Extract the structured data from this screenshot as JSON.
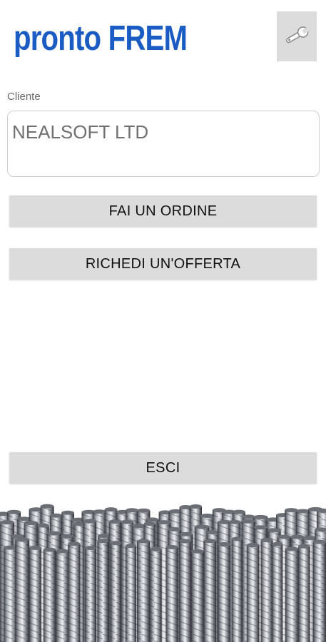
{
  "app": {
    "logo_text": "pronto FREM"
  },
  "toolbar": {
    "settings_icon": "wrench-icon"
  },
  "form": {
    "cliente_label": "Cliente",
    "cliente_value": "NEALSOFT LTD"
  },
  "actions": {
    "order_label": "FAI UN ORDINE",
    "offer_label": "RICHEDI UN'OFFERTA",
    "exit_label": "ESCI"
  },
  "colors": {
    "brand": "#1a5bc4",
    "button_bg": "#dcdcdc"
  }
}
